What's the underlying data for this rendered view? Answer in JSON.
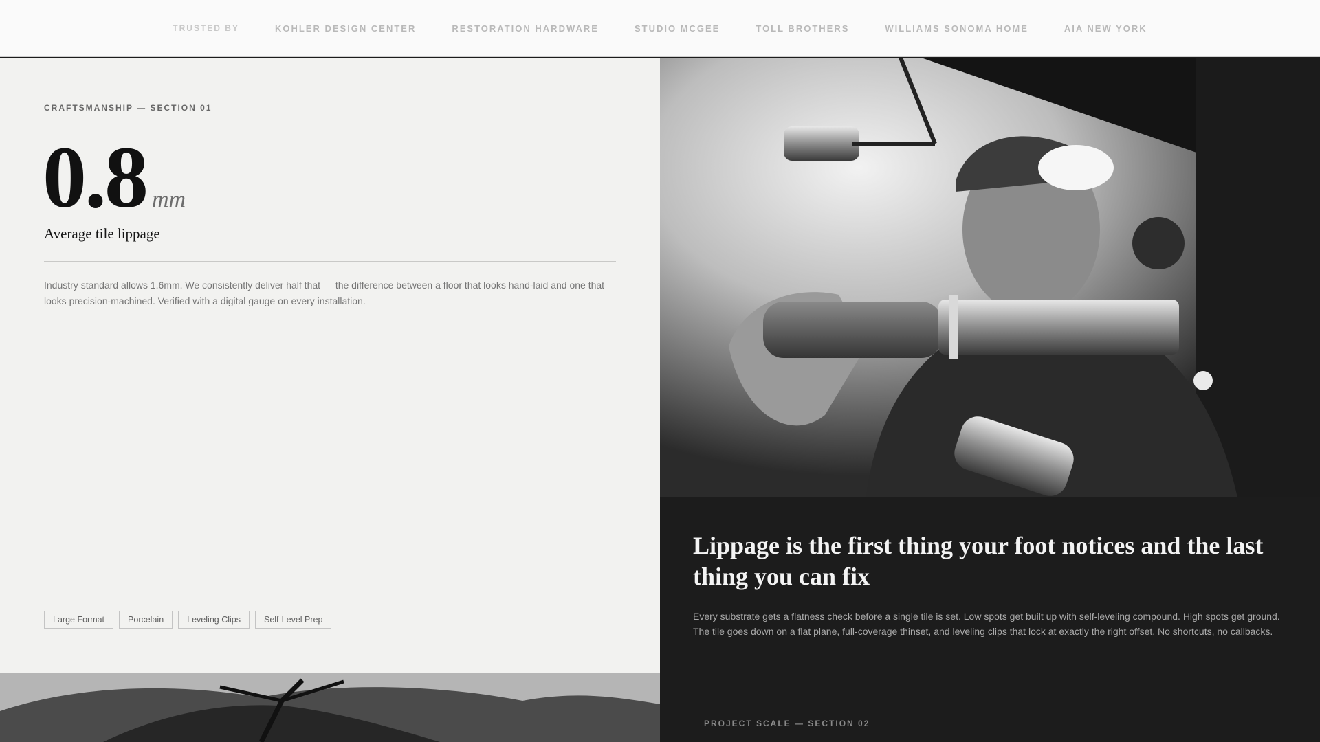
{
  "trust_bar": {
    "label": "TRUSTED BY",
    "partners": [
      "KOHLER DESIGN CENTER",
      "RESTORATION HARDWARE",
      "STUDIO MCGEE",
      "TOLL BROTHERS",
      "WILLIAMS SONOMA HOME",
      "AIA NEW YORK"
    ]
  },
  "craftsmanship": {
    "eyebrow": "CRAFTSMANSHIP — SECTION 01",
    "stat_value": "0.8",
    "stat_unit": "mm",
    "stat_label": "Average tile lippage",
    "description": "Industry standard allows 1.6mm. We consistently deliver half that — the difference between a floor that looks hand-laid and one that looks precision-machined. Verified with a digital gauge on every installation.",
    "tags": [
      "Large Format",
      "Porcelain",
      "Leveling Clips",
      "Self-Level Prep"
    ]
  },
  "feature": {
    "headline": "Lippage is the first thing your foot notices and the last thing you can fix",
    "body": "Every substrate gets a flatness check before a single tile is set. Low spots get built up with self-leveling compound. High spots get ground. The tile goes down on a flat plane, full-coverage thinset, and leveling clips that lock at exactly the right offset. No shortcuts, no callbacks."
  },
  "project_scale": {
    "eyebrow": "PROJECT SCALE — SECTION 02"
  }
}
